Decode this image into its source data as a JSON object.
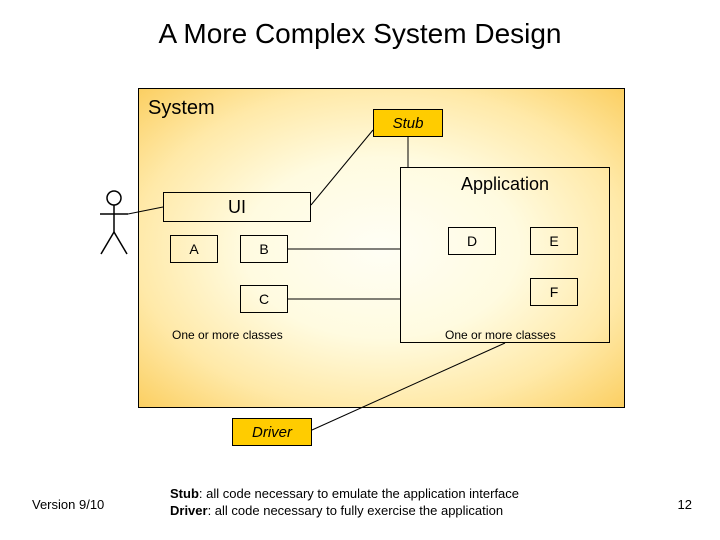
{
  "title": "A More Complex System Design",
  "system_label": "System",
  "stub_label": "Stub",
  "ui_label": "UI",
  "application_label": "Application",
  "boxes": {
    "A": "A",
    "B": "B",
    "C": "C",
    "D": "D",
    "E": "E",
    "F": "F"
  },
  "caption_ui": "One or more classes",
  "caption_app": "One or more classes",
  "driver_label": "Driver",
  "footer": {
    "version": "Version 9/10",
    "stub_def_label": "Stub",
    "stub_def": ": all code necessary to emulate the application interface",
    "driver_def_label": "Driver",
    "driver_def": ": all code necessary to fully exercise the application",
    "page": "12"
  }
}
